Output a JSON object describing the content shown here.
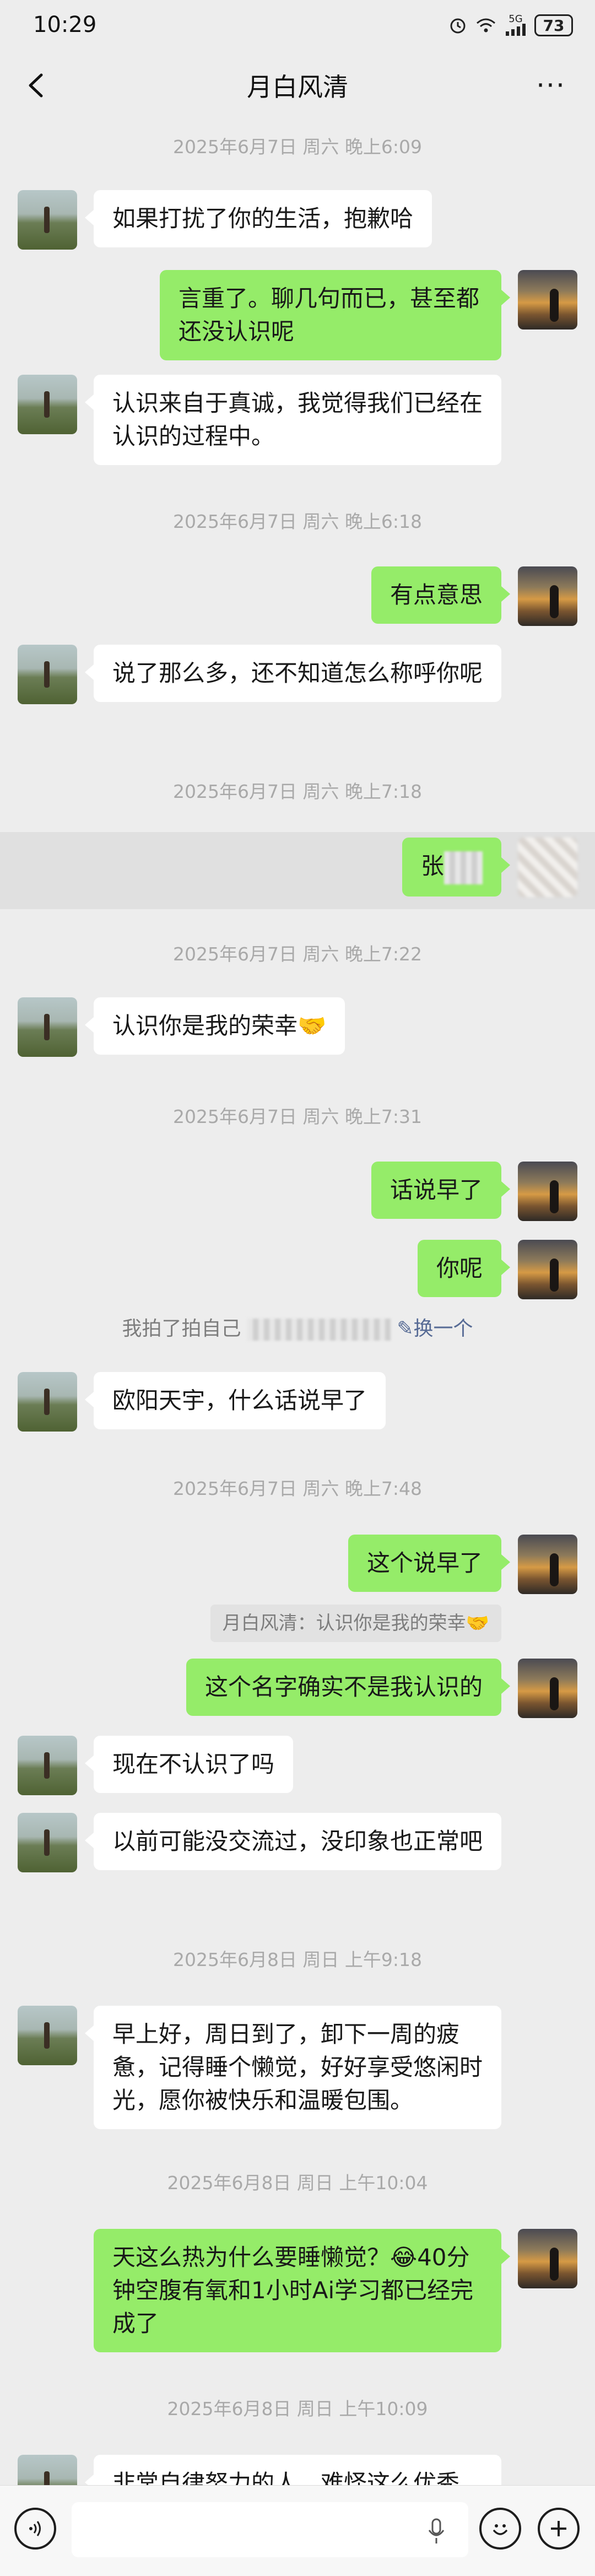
{
  "status_bar": {
    "time": "10:29",
    "signal_label": "5G",
    "battery": "73"
  },
  "header": {
    "title": "月白风清",
    "more_label": "···"
  },
  "messages": [
    {
      "kind": "time",
      "text": "2025年6月7日 周六 晚上6:09"
    },
    {
      "kind": "msg",
      "from": "other",
      "text": "如果打扰了你的生活，抱歉哈"
    },
    {
      "kind": "msg",
      "from": "me",
      "text": "言重了。聊几句而已，甚至都还没认识呢"
    },
    {
      "kind": "msg",
      "from": "other",
      "text": "认识来自于真诚，我觉得我们已经在认识的过程中。"
    },
    {
      "kind": "time",
      "text": "2025年6月7日 周六 晚上6:18"
    },
    {
      "kind": "msg",
      "from": "me",
      "text": "有点意思"
    },
    {
      "kind": "msg",
      "from": "other",
      "text": "说了那么多，还不知道怎么称呼你呢"
    },
    {
      "kind": "time",
      "text": "2025年6月7日 周六 晚上7:18"
    },
    {
      "kind": "msg",
      "from": "me",
      "text": "张"
    },
    {
      "kind": "time",
      "text": "2025年6月7日 周六 晚上7:22"
    },
    {
      "kind": "msg",
      "from": "other",
      "text": "认识你是我的荣幸🤝"
    },
    {
      "kind": "time",
      "text": "2025年6月7日 周六 晚上7:31"
    },
    {
      "kind": "msg",
      "from": "me",
      "text": "话说早了"
    },
    {
      "kind": "msg",
      "from": "me",
      "text": "你呢"
    },
    {
      "kind": "system",
      "text": "我拍了拍自己",
      "link": "换一个"
    },
    {
      "kind": "msg",
      "from": "other",
      "text": "欧阳天宇，什么话说早了"
    },
    {
      "kind": "time",
      "text": "2025年6月7日 周六 晚上7:48"
    },
    {
      "kind": "msg",
      "from": "me",
      "text": "这个说早了"
    },
    {
      "kind": "quote",
      "text": "月白风清：认识你是我的荣幸🤝"
    },
    {
      "kind": "msg",
      "from": "me",
      "text": "这个名字确实不是我认识的"
    },
    {
      "kind": "msg",
      "from": "other",
      "text": "现在不认识了吗"
    },
    {
      "kind": "msg",
      "from": "other",
      "text": "以前可能没交流过，没印象也正常吧"
    },
    {
      "kind": "time",
      "text": "2025年6月8日 周日 上午9:18"
    },
    {
      "kind": "msg",
      "from": "other",
      "text": "早上好，周日到了，卸下一周的疲惫，记得睡个懒觉，好好享受悠闲时光，愿你被快乐和温暖包围。"
    },
    {
      "kind": "time",
      "text": "2025年6月8日 周日 上午10:04"
    },
    {
      "kind": "msg",
      "from": "me",
      "text": "天这么热为什么要睡懒觉？😂40分钟空腹有氧和1小时Ai学习都已经完成了"
    },
    {
      "kind": "time",
      "text": "2025年6月8日 周日 上午10:09"
    },
    {
      "kind": "msg",
      "from": "other",
      "text": "非常自律努力的人。难怪这么优秀。"
    }
  ],
  "input": {
    "placeholder": ""
  },
  "icons": [
    "back-arrow-icon",
    "more-icon",
    "voice-icon",
    "mic-icon",
    "emoji-icon",
    "plus-icon"
  ]
}
